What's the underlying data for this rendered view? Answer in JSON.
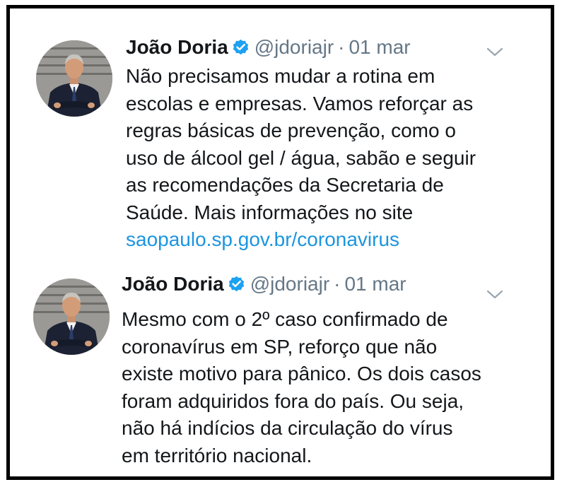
{
  "tweets": [
    {
      "author_name": "João Doria",
      "handle": "@jdoriajr",
      "separator": "·",
      "date": "01 mar",
      "lines": [
        "Não precisamos mudar a rotina em",
        "escolas e empresas. Vamos reforçar as",
        "regras básicas de prevenção, como o",
        "uso de álcool gel / água, sabão e seguir",
        "as recomendações da Secretaria de",
        "Saúde. Mais informações no site"
      ],
      "link_text": "saopaulo.sp.gov.br/coronavirus"
    },
    {
      "author_name": "João Doria",
      "handle": "@jdoriajr",
      "separator": "·",
      "date": "01 mar",
      "lines": [
        "Mesmo com o 2º caso confirmado de",
        "coronavírus em SP, reforço que não",
        "existe motivo para pânico. Os dois casos",
        "foram adquiridos fora do país. Ou seja,",
        "não há indícios da circulação do vírus",
        "em território nacional."
      ]
    }
  ],
  "icons": {
    "verified": "verified-badge-icon",
    "chevron": "chevron-down-icon",
    "avatar": "profile-photo"
  },
  "colors": {
    "text": "#14171a",
    "secondary": "#657786",
    "link": "#1b95e0",
    "verified": "#1da1f2",
    "border": "#000000"
  }
}
